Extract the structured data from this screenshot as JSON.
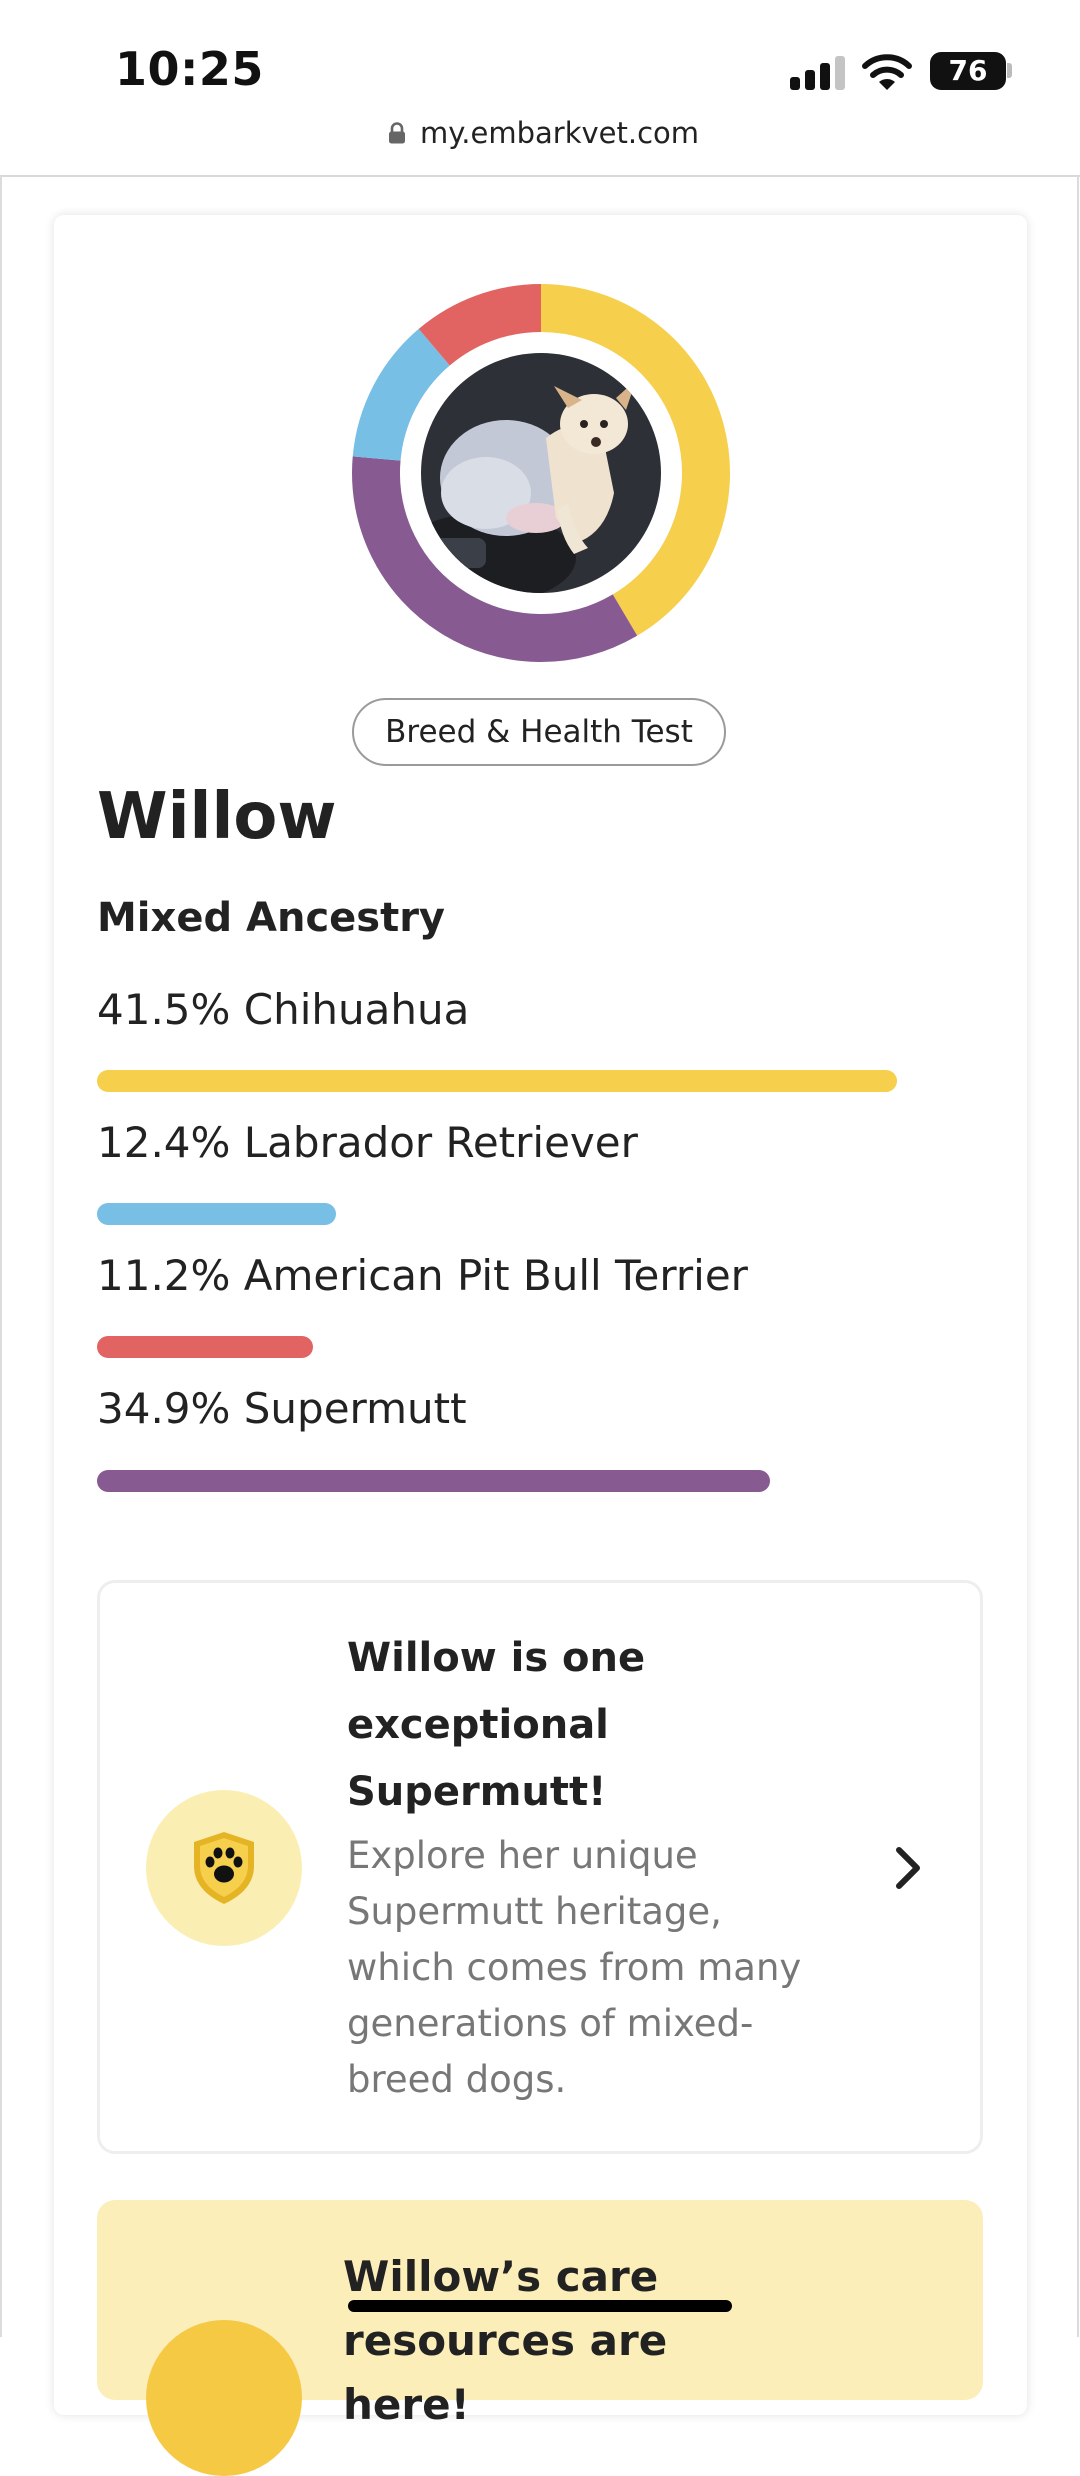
{
  "status_bar": {
    "time": "10:25",
    "battery_level": "76",
    "signal_bars": 3,
    "signal_bars_total": 4
  },
  "browser": {
    "url": "my.embarkvet.com",
    "lock_icon": "lock-icon"
  },
  "profile": {
    "photo_icon": "dog-photo",
    "test_label": "Breed & Health Test",
    "dog_name": "Willow"
  },
  "ancestry": {
    "title": "Mixed Ancestry",
    "breeds": [
      {
        "label": "41.5% Chihuahua",
        "percent": 41.5,
        "color": "#f6cf4d"
      },
      {
        "label": "12.4% Labrador Retriever",
        "percent": 12.4,
        "color": "#78bfe6"
      },
      {
        "label": "11.2% American Pit Bull Terrier",
        "percent": 11.2,
        "color": "#e26462"
      },
      {
        "label": "34.9% Supermutt",
        "percent": 34.9,
        "color": "#875b91"
      }
    ]
  },
  "supermutt_card": {
    "title": "Willow is one exceptional Supermutt!",
    "description": "Explore her unique Supermutt heritage, which comes from many generations of mixed-breed dogs.",
    "icon": "paw-shield-icon",
    "arrow_icon": "chevron-right-icon",
    "badge_bg_color": "#fbeeb3"
  },
  "care_card": {
    "title": "Willow’s care resources are here!",
    "bg_color": "#fbeeb9"
  }
}
